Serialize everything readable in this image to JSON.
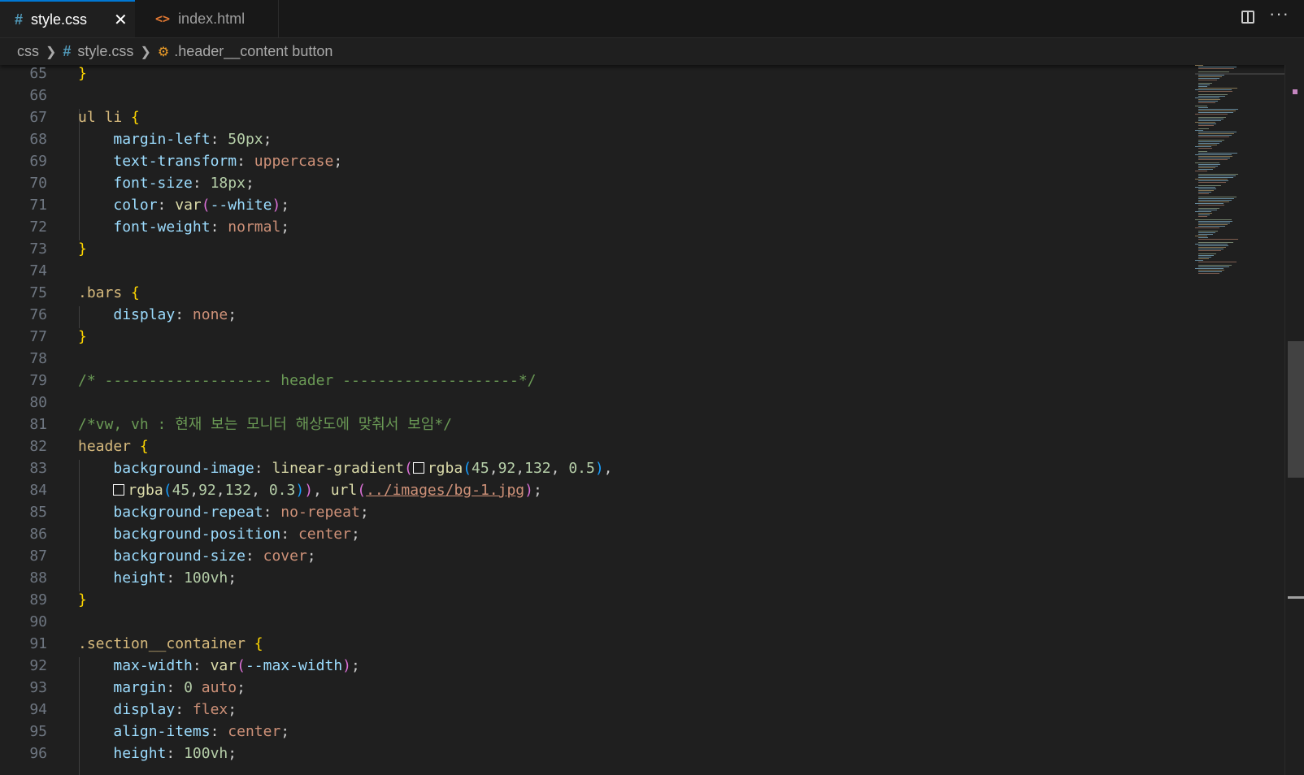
{
  "tabs": [
    {
      "label": "style.css",
      "icon": "css-hash-icon",
      "active": true,
      "close": "✕"
    },
    {
      "label": "index.html",
      "icon": "html-code-icon",
      "active": false
    }
  ],
  "actions": {
    "split_icon": "split-editor-icon",
    "more": "···"
  },
  "breadcrumb": {
    "folder": "css",
    "file": "style.css",
    "symbol": ".header__content button"
  },
  "colors": {
    "active_tab_border": "#0078d4",
    "css_icon": "#519aba",
    "html_icon": "#e37933"
  },
  "lines": [
    {
      "n": "65",
      "t": [
        [
          "}",
          "b1"
        ]
      ]
    },
    {
      "n": "66",
      "t": []
    },
    {
      "n": "67",
      "t": [
        [
          "ul li ",
          "sel"
        ],
        [
          "{",
          "b1"
        ]
      ]
    },
    {
      "n": "68",
      "t": [
        [
          "    "
        ],
        [
          "margin-left",
          "prop"
        ],
        [
          ": ",
          "p"
        ],
        [
          "50px",
          "num"
        ],
        [
          ";",
          "p"
        ]
      ]
    },
    {
      "n": "69",
      "t": [
        [
          "    "
        ],
        [
          "text-transform",
          "prop"
        ],
        [
          ": ",
          "p"
        ],
        [
          "uppercase",
          "val"
        ],
        [
          ";",
          "p"
        ]
      ]
    },
    {
      "n": "70",
      "t": [
        [
          "    "
        ],
        [
          "font-size",
          "prop"
        ],
        [
          ": ",
          "p"
        ],
        [
          "18px",
          "num"
        ],
        [
          ";",
          "p"
        ]
      ]
    },
    {
      "n": "71",
      "t": [
        [
          "    "
        ],
        [
          "color",
          "prop"
        ],
        [
          ": ",
          "p"
        ],
        [
          "var",
          "fn"
        ],
        [
          "(",
          "b2"
        ],
        [
          "--white",
          "prop"
        ],
        [
          ")",
          "b2"
        ],
        [
          ";",
          "p"
        ]
      ]
    },
    {
      "n": "72",
      "t": [
        [
          "    "
        ],
        [
          "font-weight",
          "prop"
        ],
        [
          ": ",
          "p"
        ],
        [
          "normal",
          "val"
        ],
        [
          ";",
          "p"
        ]
      ]
    },
    {
      "n": "73",
      "t": [
        [
          "}",
          "b1"
        ]
      ]
    },
    {
      "n": "74",
      "t": []
    },
    {
      "n": "75",
      "t": [
        [
          ".bars ",
          "sel"
        ],
        [
          "{",
          "b1"
        ]
      ]
    },
    {
      "n": "76",
      "t": [
        [
          "    "
        ],
        [
          "display",
          "prop"
        ],
        [
          ": ",
          "p"
        ],
        [
          "none",
          "val"
        ],
        [
          ";",
          "p"
        ]
      ]
    },
    {
      "n": "77",
      "t": [
        [
          "}",
          "b1"
        ]
      ]
    },
    {
      "n": "78",
      "t": []
    },
    {
      "n": "79",
      "t": [
        [
          "/* ------------------- header --------------------*/",
          "com"
        ]
      ]
    },
    {
      "n": "80",
      "t": []
    },
    {
      "n": "81",
      "t": [
        [
          "/*vw, vh : 현재 보는 모니터 해상도에 맞춰서 보임*/",
          "com"
        ]
      ]
    },
    {
      "n": "82",
      "t": [
        [
          "header ",
          "sel"
        ],
        [
          "{",
          "b1"
        ]
      ]
    },
    {
      "n": "83",
      "t": [
        [
          "    "
        ],
        [
          "background-image",
          "prop"
        ],
        [
          ": ",
          "p"
        ],
        [
          "linear-gradient",
          "fn"
        ],
        [
          "(",
          "b2"
        ],
        [
          "",
          "swatch"
        ],
        [
          "rgba",
          "fn"
        ],
        [
          "(",
          "b3"
        ],
        [
          "45",
          "num"
        ],
        [
          ",",
          "p"
        ],
        [
          "92",
          "num"
        ],
        [
          ",",
          "p"
        ],
        [
          "132",
          "num"
        ],
        [
          ", ",
          "p"
        ],
        [
          "0.5",
          "num"
        ],
        [
          ")",
          "b3"
        ],
        [
          ",",
          "p"
        ]
      ]
    },
    {
      "n": "84",
      "t": [
        [
          "    "
        ],
        [
          "",
          "swatch"
        ],
        [
          "rgba",
          "fn"
        ],
        [
          "(",
          "b3"
        ],
        [
          "45",
          "num"
        ],
        [
          ",",
          "p"
        ],
        [
          "92",
          "num"
        ],
        [
          ",",
          "p"
        ],
        [
          "132",
          "num"
        ],
        [
          ", ",
          "p"
        ],
        [
          "0.3",
          "num"
        ],
        [
          ")",
          "b3"
        ],
        [
          ")",
          "b2"
        ],
        [
          ", ",
          "p"
        ],
        [
          "url",
          "fn"
        ],
        [
          "(",
          "b2"
        ],
        [
          "../images/bg-1.jpg",
          "url"
        ],
        [
          ")",
          "b2"
        ],
        [
          ";",
          "p"
        ]
      ]
    },
    {
      "n": "85",
      "t": [
        [
          "    "
        ],
        [
          "background-repeat",
          "prop"
        ],
        [
          ": ",
          "p"
        ],
        [
          "no-repeat",
          "val"
        ],
        [
          ";",
          "p"
        ]
      ]
    },
    {
      "n": "86",
      "t": [
        [
          "    "
        ],
        [
          "background-position",
          "prop"
        ],
        [
          ": ",
          "p"
        ],
        [
          "center",
          "val"
        ],
        [
          ";",
          "p"
        ]
      ]
    },
    {
      "n": "87",
      "t": [
        [
          "    "
        ],
        [
          "background-size",
          "prop"
        ],
        [
          ": ",
          "p"
        ],
        [
          "cover",
          "val"
        ],
        [
          ";",
          "p"
        ]
      ]
    },
    {
      "n": "88",
      "t": [
        [
          "    "
        ],
        [
          "height",
          "prop"
        ],
        [
          ": ",
          "p"
        ],
        [
          "100vh",
          "num"
        ],
        [
          ";",
          "p"
        ]
      ]
    },
    {
      "n": "89",
      "t": [
        [
          "}",
          "b1"
        ]
      ]
    },
    {
      "n": "90",
      "t": []
    },
    {
      "n": "91",
      "t": [
        [
          ".section__container ",
          "sel"
        ],
        [
          "{",
          "b1"
        ]
      ]
    },
    {
      "n": "92",
      "t": [
        [
          "    "
        ],
        [
          "max-width",
          "prop"
        ],
        [
          ": ",
          "p"
        ],
        [
          "var",
          "fn"
        ],
        [
          "(",
          "b2"
        ],
        [
          "--max-width",
          "prop"
        ],
        [
          ")",
          "b2"
        ],
        [
          ";",
          "p"
        ]
      ]
    },
    {
      "n": "93",
      "t": [
        [
          "    "
        ],
        [
          "margin",
          "prop"
        ],
        [
          ": ",
          "p"
        ],
        [
          "0",
          "num"
        ],
        [
          " ",
          "p"
        ],
        [
          "auto",
          "val"
        ],
        [
          ";",
          "p"
        ]
      ]
    },
    {
      "n": "94",
      "t": [
        [
          "    "
        ],
        [
          "display",
          "prop"
        ],
        [
          ": ",
          "p"
        ],
        [
          "flex",
          "val"
        ],
        [
          ";",
          "p"
        ]
      ]
    },
    {
      "n": "95",
      "t": [
        [
          "    "
        ],
        [
          "align-items",
          "prop"
        ],
        [
          ": ",
          "p"
        ],
        [
          "center",
          "val"
        ],
        [
          ";",
          "p"
        ]
      ]
    },
    {
      "n": "96",
      "t": [
        [
          "    "
        ],
        [
          "height",
          "prop"
        ],
        [
          ": ",
          "p"
        ],
        [
          "100vh",
          "num"
        ],
        [
          ";",
          "p"
        ]
      ]
    }
  ]
}
